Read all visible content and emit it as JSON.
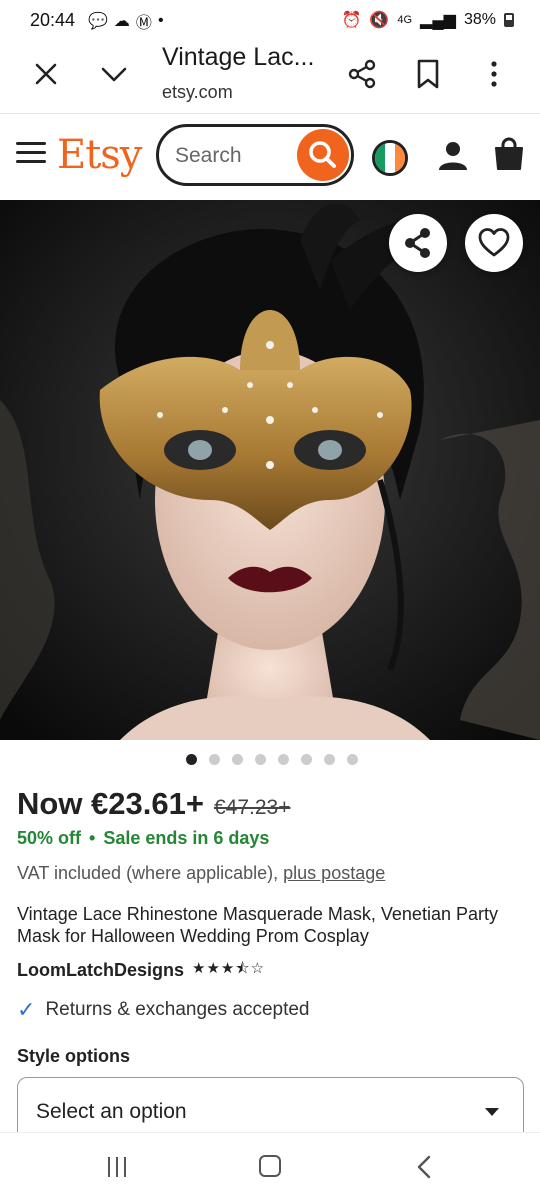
{
  "status_bar": {
    "time": "20:44",
    "network": "4G",
    "battery": "38%"
  },
  "custom_tab": {
    "title": "Vintage Lac...",
    "domain": "etsy.com"
  },
  "etsy": {
    "logo": "Etsy",
    "search_placeholder": "Search",
    "brand_color": "#F1641E"
  },
  "carousel": {
    "image_count": 8,
    "active_index": 0
  },
  "listing": {
    "price": "Now €23.61+",
    "original_price": "€47.23+",
    "discount": "50% off",
    "sale_bullet": "•",
    "sale_ends": "Sale ends in 6 days",
    "vat": "VAT included (where applicable),",
    "postage_link": "plus postage",
    "title": "Vintage Lace Rhinestone Masquerade Mask, Venetian Party Mask for Halloween Wedding Prom Cosplay",
    "shop_name": "LoomLatchDesigns",
    "rating": 3.5,
    "stars": "★★★⯪☆",
    "returns": "Returns & exchanges accepted",
    "style_label": "Style options",
    "style_select": "Select an option"
  },
  "colors": {
    "sale_green": "#258635",
    "check_blue": "#2f6fd6"
  }
}
